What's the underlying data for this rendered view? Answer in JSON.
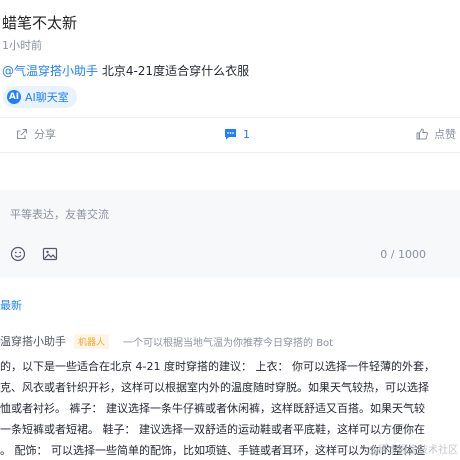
{
  "post": {
    "author": "蜡笔不太新",
    "time": "1小时前",
    "mention": "@气温穿搭小助手",
    "content": " 北京4-21度适合穿什么衣服",
    "ai_chip": {
      "logo": "AI",
      "label": "AI聊天室"
    }
  },
  "actions": {
    "share_icon": "share-icon",
    "share_label": "分享",
    "comment_icon": "comment-icon",
    "comment_count": "1",
    "like_icon": "thumbs-up-icon",
    "like_label": "点赞"
  },
  "comment_box": {
    "placeholder": "平等表达，友善交流",
    "emoji_icon": "emoji-icon",
    "image_icon": "image-icon",
    "char_count": "0 / 1000"
  },
  "latest_label": "最新",
  "bot_reply": {
    "name": "温穿搭小助手",
    "badge": "机器人",
    "description": "一个可以根据当地气温为你推荐今日穿搭的 Bot",
    "lines": [
      "的，以下是一些适合在北京 4-21 度时穿搭的建议： 上衣： 你可以选择一件轻薄的外套，",
      "克、风衣或者针织开衫，这样可以根据室内外的温度随时穿脱。如果天气较热，可以选择",
      "恤或者衬衫。 裤子： 建议选择一条牛仔裤或者休闲裤，这样既舒适又百搭。如果天气较",
      "一条短裤或者短裙。 鞋子： 建议选择一双舒适的运动鞋或者平底鞋，这样可以方便你在",
      "。 配饰： 可以选择一些简单的配饰，比如项链、手链或者耳环，这样可以为你的整体造"
    ]
  },
  "watermark": "@稀土掘金技术社区",
  "colors": {
    "accent": "#1e80ff",
    "muted": "#8a919f",
    "badge_text": "#f5a623",
    "badge_bg": "#fff4e5",
    "chip_bg": "#eaf2ff",
    "comment_bg": "#f7f8fa"
  }
}
